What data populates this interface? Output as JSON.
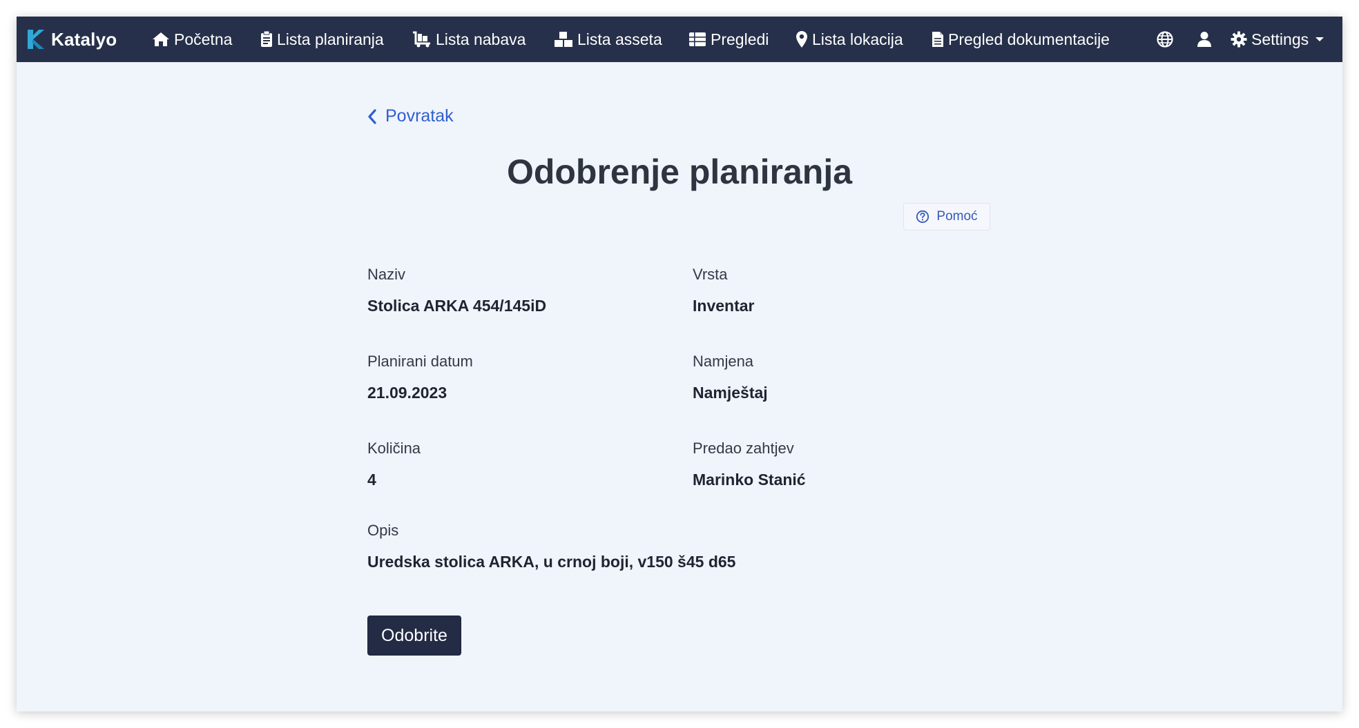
{
  "navbar": {
    "brand": "Katalyo",
    "items": [
      {
        "label": "Početna",
        "icon": "home-icon"
      },
      {
        "label": "Lista planiranja",
        "icon": "clipboard-icon"
      },
      {
        "label": "Lista nabava",
        "icon": "cart-icon"
      },
      {
        "label": "Lista asseta",
        "icon": "boxes-icon"
      },
      {
        "label": "Pregledi",
        "icon": "table-icon"
      },
      {
        "label": "Lista lokacija",
        "icon": "map-marker-icon"
      },
      {
        "label": "Pregled dokumentacije",
        "icon": "document-icon"
      }
    ],
    "language_icon": "globe-icon",
    "user_icon": "user-icon",
    "settings_label": "Settings",
    "colors": {
      "background": "#27304a",
      "brand_accent": "#2fa8d8"
    }
  },
  "back_link": {
    "label": "Povratak",
    "icon": "chevron-left-icon"
  },
  "page_title": "Odobrenje planiranja",
  "help_button": {
    "label": "Pomoć",
    "icon": "question-circle-icon"
  },
  "fields": {
    "naziv": {
      "label": "Naziv",
      "value": "Stolica ARKA 454/145iD"
    },
    "vrsta": {
      "label": "Vrsta",
      "value": "Inventar"
    },
    "planirani_datum": {
      "label": "Planirani datum",
      "value": "21.09.2023"
    },
    "namjena": {
      "label": "Namjena",
      "value": "Namještaj"
    },
    "kolicina": {
      "label": "Količina",
      "value": "4"
    },
    "predao_zahtjev": {
      "label": "Predao zahtjev",
      "value": "Marinko Stanić"
    },
    "opis": {
      "label": "Opis",
      "value": "Uredska stolica ARKA, u crnoj boji, v150 š45 d65"
    }
  },
  "approve_button": {
    "label": "Odobrite"
  },
  "colors": {
    "page_background": "#f0f4fb",
    "link": "#2f5fd0",
    "primary_button": "#232b45"
  }
}
